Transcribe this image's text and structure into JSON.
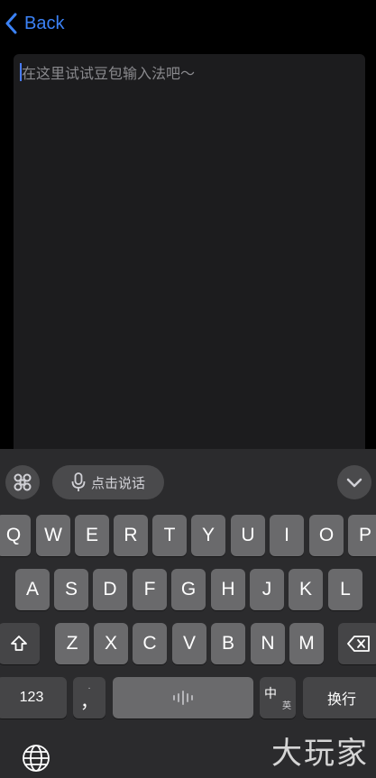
{
  "nav": {
    "back_label": "Back"
  },
  "editor": {
    "placeholder": "在这里试试豆包输入法吧～"
  },
  "keyboard": {
    "voice_label": "点击说话",
    "row1": [
      "Q",
      "W",
      "E",
      "R",
      "T",
      "Y",
      "U",
      "I",
      "O",
      "P"
    ],
    "row2": [
      "A",
      "S",
      "D",
      "F",
      "G",
      "H",
      "J",
      "K",
      "L"
    ],
    "row3": [
      "Z",
      "X",
      "C",
      "V",
      "B",
      "N",
      "M"
    ],
    "numbers_label": "123",
    "punct_label": "，",
    "lang_main": "中",
    "lang_sub": "英",
    "return_label": "换行"
  },
  "watermark": "大玩家"
}
